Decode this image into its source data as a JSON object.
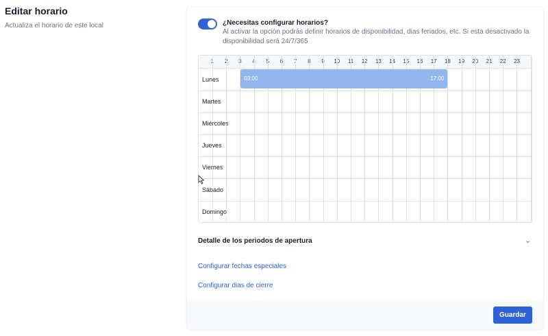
{
  "page": {
    "title": "Editar horario",
    "subtitle": "Actualiza el horario de este local"
  },
  "toggle": {
    "enabled": true,
    "title": "¿Necesitas configurar horarios?",
    "description": "Al activar la opción podrás definir horarios de disponibilidad, dias feriados, etc. Si esta desactivado la disponibilidad será 24/7/365"
  },
  "schedule": {
    "hours": [
      "1",
      "2",
      "3",
      "4",
      "5",
      "6",
      "7",
      "8",
      "9",
      "10",
      "11",
      "12",
      "13",
      "14",
      "15",
      "16",
      "17",
      "18",
      "19",
      "20",
      "21",
      "22",
      "23"
    ],
    "days": [
      {
        "label": "Lunes"
      },
      {
        "label": "Martes"
      },
      {
        "label": "Miércoles"
      },
      {
        "label": "Jueves"
      },
      {
        "label": "Viernes"
      },
      {
        "label": "Sábado"
      },
      {
        "label": "Domingo"
      }
    ],
    "blocks": [
      {
        "day": "Lunes",
        "start": "03:00",
        "end": "17:00"
      }
    ]
  },
  "detail": {
    "label": "Detalle de los periodos de apertura",
    "chevron_icon": "chevron-down-icon"
  },
  "links": {
    "special_dates": "Configurar fechas especiales",
    "closing_days": "Configurar dias de cierre"
  },
  "footer": {
    "save_label": "Guardar"
  },
  "colors": {
    "accent": "#2f63d6",
    "block": "#93b5ee",
    "border": "#dfe2e7",
    "muted_text": "#6b7280"
  }
}
